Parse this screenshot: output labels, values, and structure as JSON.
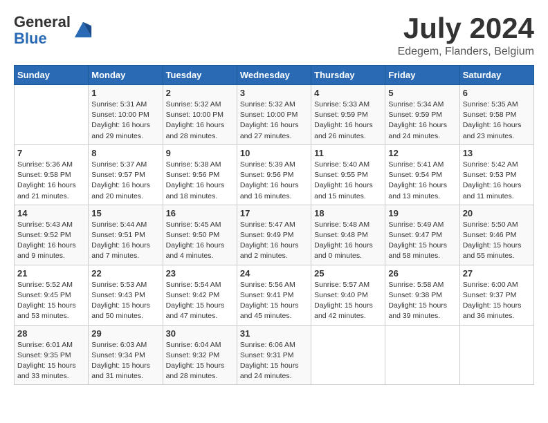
{
  "logo": {
    "general": "General",
    "blue": "Blue"
  },
  "title": "July 2024",
  "location": "Edegem, Flanders, Belgium",
  "days_header": [
    "Sunday",
    "Monday",
    "Tuesday",
    "Wednesday",
    "Thursday",
    "Friday",
    "Saturday"
  ],
  "weeks": [
    [
      {
        "day": "",
        "info": ""
      },
      {
        "day": "1",
        "info": "Sunrise: 5:31 AM\nSunset: 10:00 PM\nDaylight: 16 hours\nand 29 minutes."
      },
      {
        "day": "2",
        "info": "Sunrise: 5:32 AM\nSunset: 10:00 PM\nDaylight: 16 hours\nand 28 minutes."
      },
      {
        "day": "3",
        "info": "Sunrise: 5:32 AM\nSunset: 10:00 PM\nDaylight: 16 hours\nand 27 minutes."
      },
      {
        "day": "4",
        "info": "Sunrise: 5:33 AM\nSunset: 9:59 PM\nDaylight: 16 hours\nand 26 minutes."
      },
      {
        "day": "5",
        "info": "Sunrise: 5:34 AM\nSunset: 9:59 PM\nDaylight: 16 hours\nand 24 minutes."
      },
      {
        "day": "6",
        "info": "Sunrise: 5:35 AM\nSunset: 9:58 PM\nDaylight: 16 hours\nand 23 minutes."
      }
    ],
    [
      {
        "day": "7",
        "info": "Sunrise: 5:36 AM\nSunset: 9:58 PM\nDaylight: 16 hours\nand 21 minutes."
      },
      {
        "day": "8",
        "info": "Sunrise: 5:37 AM\nSunset: 9:57 PM\nDaylight: 16 hours\nand 20 minutes."
      },
      {
        "day": "9",
        "info": "Sunrise: 5:38 AM\nSunset: 9:56 PM\nDaylight: 16 hours\nand 18 minutes."
      },
      {
        "day": "10",
        "info": "Sunrise: 5:39 AM\nSunset: 9:56 PM\nDaylight: 16 hours\nand 16 minutes."
      },
      {
        "day": "11",
        "info": "Sunrise: 5:40 AM\nSunset: 9:55 PM\nDaylight: 16 hours\nand 15 minutes."
      },
      {
        "day": "12",
        "info": "Sunrise: 5:41 AM\nSunset: 9:54 PM\nDaylight: 16 hours\nand 13 minutes."
      },
      {
        "day": "13",
        "info": "Sunrise: 5:42 AM\nSunset: 9:53 PM\nDaylight: 16 hours\nand 11 minutes."
      }
    ],
    [
      {
        "day": "14",
        "info": "Sunrise: 5:43 AM\nSunset: 9:52 PM\nDaylight: 16 hours\nand 9 minutes."
      },
      {
        "day": "15",
        "info": "Sunrise: 5:44 AM\nSunset: 9:51 PM\nDaylight: 16 hours\nand 7 minutes."
      },
      {
        "day": "16",
        "info": "Sunrise: 5:45 AM\nSunset: 9:50 PM\nDaylight: 16 hours\nand 4 minutes."
      },
      {
        "day": "17",
        "info": "Sunrise: 5:47 AM\nSunset: 9:49 PM\nDaylight: 16 hours\nand 2 minutes."
      },
      {
        "day": "18",
        "info": "Sunrise: 5:48 AM\nSunset: 9:48 PM\nDaylight: 16 hours\nand 0 minutes."
      },
      {
        "day": "19",
        "info": "Sunrise: 5:49 AM\nSunset: 9:47 PM\nDaylight: 15 hours\nand 58 minutes."
      },
      {
        "day": "20",
        "info": "Sunrise: 5:50 AM\nSunset: 9:46 PM\nDaylight: 15 hours\nand 55 minutes."
      }
    ],
    [
      {
        "day": "21",
        "info": "Sunrise: 5:52 AM\nSunset: 9:45 PM\nDaylight: 15 hours\nand 53 minutes."
      },
      {
        "day": "22",
        "info": "Sunrise: 5:53 AM\nSunset: 9:43 PM\nDaylight: 15 hours\nand 50 minutes."
      },
      {
        "day": "23",
        "info": "Sunrise: 5:54 AM\nSunset: 9:42 PM\nDaylight: 15 hours\nand 47 minutes."
      },
      {
        "day": "24",
        "info": "Sunrise: 5:56 AM\nSunset: 9:41 PM\nDaylight: 15 hours\nand 45 minutes."
      },
      {
        "day": "25",
        "info": "Sunrise: 5:57 AM\nSunset: 9:40 PM\nDaylight: 15 hours\nand 42 minutes."
      },
      {
        "day": "26",
        "info": "Sunrise: 5:58 AM\nSunset: 9:38 PM\nDaylight: 15 hours\nand 39 minutes."
      },
      {
        "day": "27",
        "info": "Sunrise: 6:00 AM\nSunset: 9:37 PM\nDaylight: 15 hours\nand 36 minutes."
      }
    ],
    [
      {
        "day": "28",
        "info": "Sunrise: 6:01 AM\nSunset: 9:35 PM\nDaylight: 15 hours\nand 33 minutes."
      },
      {
        "day": "29",
        "info": "Sunrise: 6:03 AM\nSunset: 9:34 PM\nDaylight: 15 hours\nand 31 minutes."
      },
      {
        "day": "30",
        "info": "Sunrise: 6:04 AM\nSunset: 9:32 PM\nDaylight: 15 hours\nand 28 minutes."
      },
      {
        "day": "31",
        "info": "Sunrise: 6:06 AM\nSunset: 9:31 PM\nDaylight: 15 hours\nand 24 minutes."
      },
      {
        "day": "",
        "info": ""
      },
      {
        "day": "",
        "info": ""
      },
      {
        "day": "",
        "info": ""
      }
    ]
  ]
}
